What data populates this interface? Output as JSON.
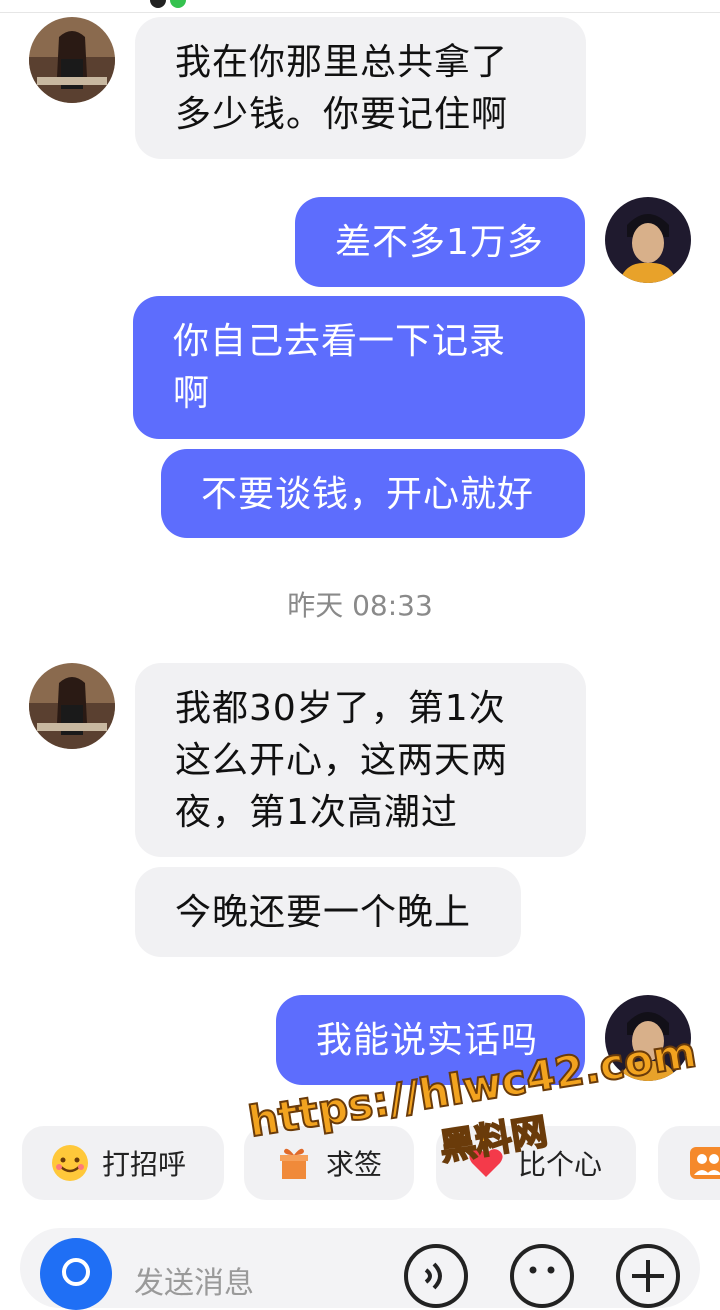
{
  "messages": {
    "m1": {
      "line1": "我在你那里总共拿了",
      "line2": "多少钱。你要记住啊"
    },
    "m2": "差不多1万多",
    "m3": {
      "line1": "你自己去看一下记录",
      "line2": "啊"
    },
    "m4": "不要谈钱，开心就好",
    "m5": {
      "line1": "我都30岁了，第1次",
      "line2": "这么开心，这两天两",
      "line3": "夜，第1次高潮过"
    },
    "m6": "今晚还要一个晚上",
    "m7": "我能说实话吗"
  },
  "timestamp": "昨天 08:33",
  "quick_replies": {
    "greet": "打招呼",
    "gift": "求签",
    "heart": "比个心"
  },
  "input": {
    "placeholder": "发送消息"
  },
  "watermark": {
    "url": "https://hlwc42.com",
    "name": "黑料网"
  },
  "colors": {
    "outgoing_bubble": "#5d6dfd",
    "incoming_bubble": "#f1f1f3",
    "camera_button": "#1f6ff5"
  },
  "icons": [
    "camera-icon",
    "voice-icon",
    "emoji-icon",
    "plus-icon",
    "smile-emoji-icon",
    "gift-icon",
    "heart-icon",
    "group-icon"
  ]
}
